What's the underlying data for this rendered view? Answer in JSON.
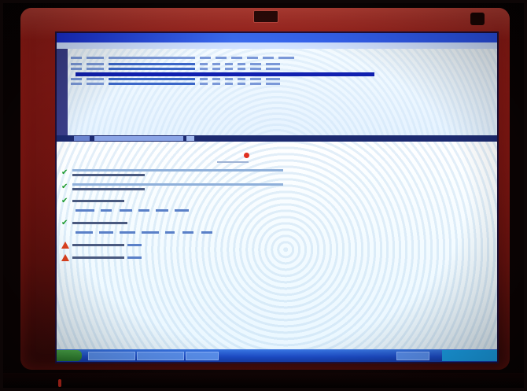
{
  "photo": {
    "subject": "",
    "colors": {
      "bezel": "#7c1612",
      "background": "#0b0303",
      "title_bar": "#2a50e8",
      "content_bg": "#f3fbff",
      "ok_icon": "#1a9a2a",
      "warn_icon": "#d9401e",
      "logo_mark": "#e03020"
    }
  },
  "screen": {
    "logo_text": "",
    "entries": [
      {
        "icon": "check-icon",
        "status": "ok"
      },
      {
        "icon": "check-icon",
        "status": "ok"
      },
      {
        "icon": "check-icon",
        "status": "ok"
      },
      {
        "icon": "check-icon",
        "status": "ok"
      },
      {
        "icon": "warning-icon",
        "status": "error"
      },
      {
        "icon": "warning-icon",
        "status": "error"
      }
    ]
  }
}
